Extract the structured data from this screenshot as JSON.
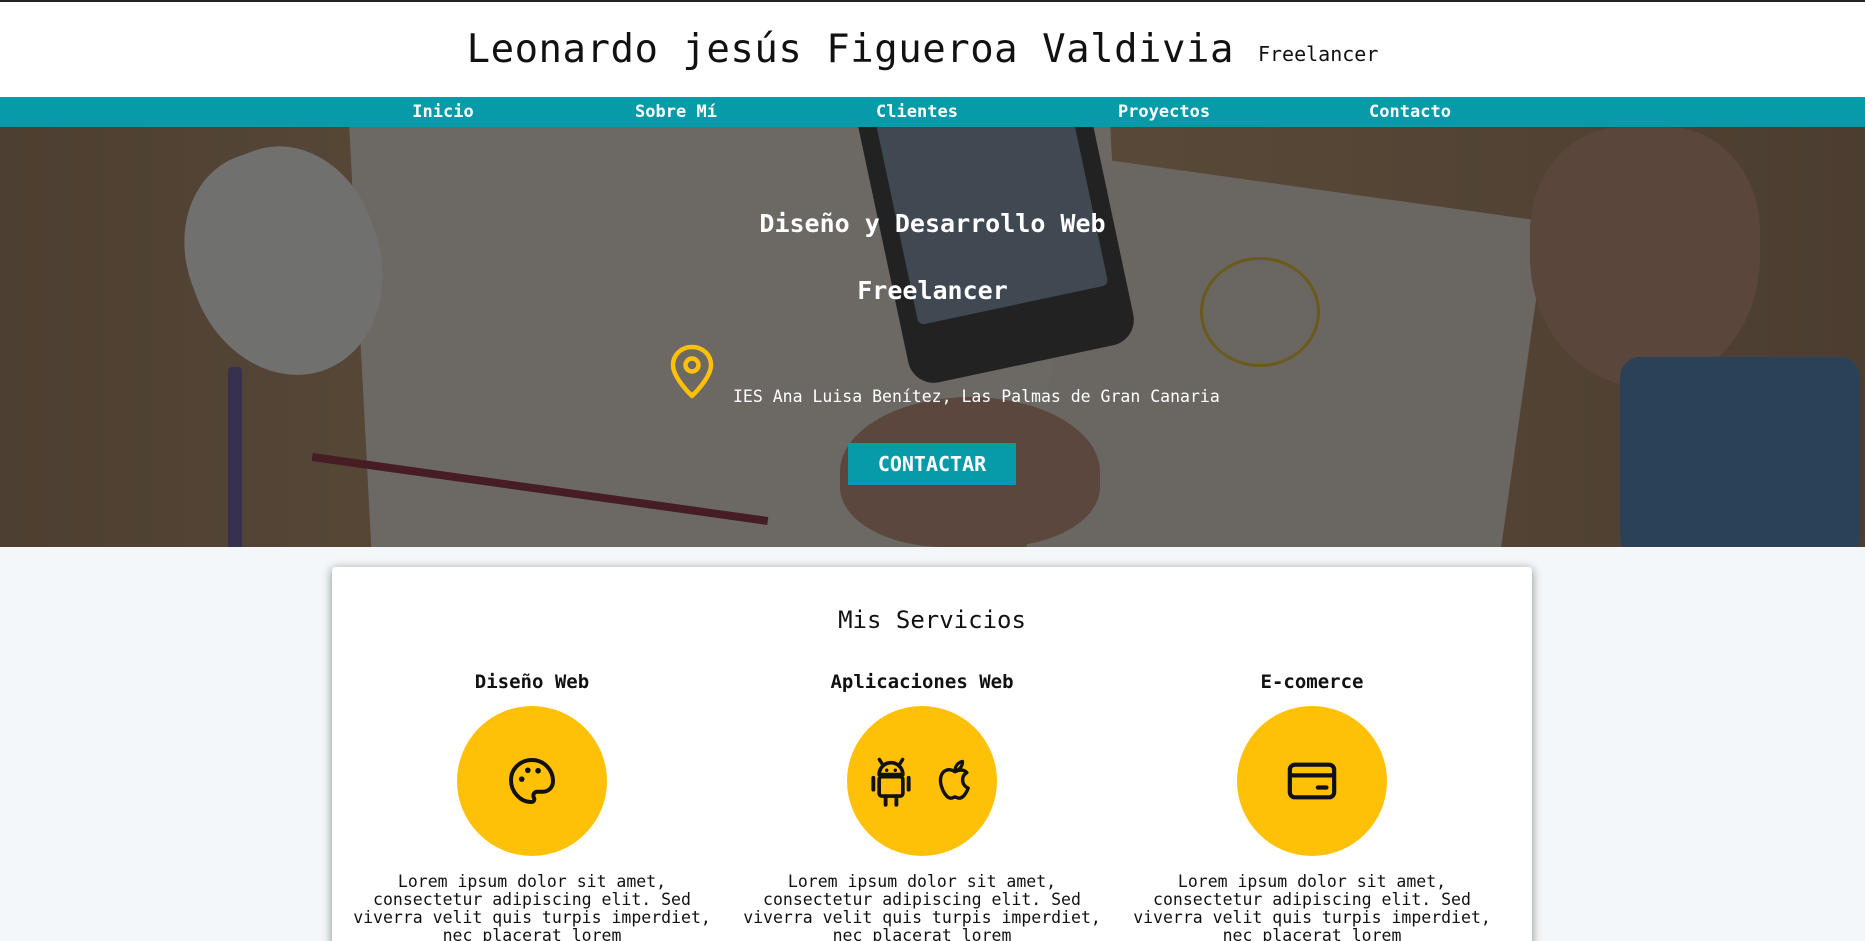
{
  "header": {
    "name": "Leonardo jesús Figueroa Valdivia",
    "role": "Freelancer"
  },
  "nav": {
    "items": [
      "Inicio",
      "Sobre Mí",
      "Clientes",
      "Proyectos",
      "Contacto"
    ]
  },
  "hero": {
    "title": "Diseño y Desarrollo Web",
    "subtitle": "Freelancer",
    "location_icon": "map-pin-icon",
    "location": "IES Ana Luisa Benítez, Las Palmas de Gran Canaria",
    "cta": "CONTACTAR"
  },
  "services": {
    "heading": "Mis Servicios",
    "items": [
      {
        "title": "Diseño Web",
        "icons": [
          "palette-icon"
        ],
        "description": "Lorem ipsum dolor sit amet, consectetur adipiscing elit. Sed viverra velit quis turpis imperdiet, nec placerat lorem"
      },
      {
        "title": "Aplicaciones Web",
        "icons": [
          "android-icon",
          "apple-icon"
        ],
        "description": "Lorem ipsum dolor sit amet, consectetur adipiscing elit. Sed viverra velit quis turpis imperdiet, nec placerat lorem"
      },
      {
        "title": "E-comerce",
        "icons": [
          "credit-card-icon"
        ],
        "description": "Lorem ipsum dolor sit amet, consectetur adipiscing elit. Sed viverra velit quis turpis imperdiet, nec placerat lorem"
      }
    ]
  },
  "colors": {
    "accent": "#079aa9",
    "highlight": "#ffc107",
    "background": "#f4f7f9"
  }
}
